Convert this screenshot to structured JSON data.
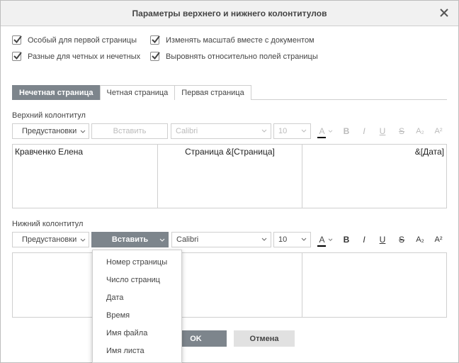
{
  "dialog": {
    "title": "Параметры верхнего и нижнего колонтитулов"
  },
  "options": {
    "first_page": "Особый для первой страницы",
    "odd_even": "Разные для четных и нечетных",
    "scale_with_doc": "Изменять масштаб вместе с документом",
    "align_margins": "Выровнять относительно полей страницы"
  },
  "tabs": [
    "Нечетная страница",
    "Четная страница",
    "Первая страница"
  ],
  "header": {
    "label": "Верхний колонтитул",
    "presets": "Предустановки",
    "insert": "Вставить",
    "font": "Calibri",
    "size": "10",
    "left": "Кравченко Елена",
    "center": "Страница &[Страница]",
    "right": "&[Дата]"
  },
  "footer": {
    "label": "Нижний колонтитул",
    "presets": "Предустановки",
    "insert": "Вставить",
    "font": "Calibri",
    "size": "10",
    "left": "",
    "center": "",
    "right": ""
  },
  "format": {
    "font_color": "A",
    "bold": "B",
    "italic": "I",
    "underline": "U",
    "strike": "S",
    "subscript": "A₂",
    "superscript": "A²"
  },
  "insert_menu": [
    "Номер страницы",
    "Число страниц",
    "Дата",
    "Время",
    "Имя файла",
    "Имя листа"
  ],
  "buttons": {
    "ok": "OK",
    "cancel": "Отмена"
  },
  "colors": {
    "accent": "#7d858c",
    "font_color_bar": "#000000"
  }
}
